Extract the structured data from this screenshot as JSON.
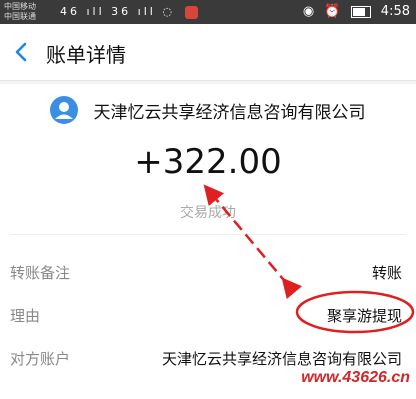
{
  "status_bar": {
    "carrier_1": "中国移动",
    "carrier_2": "中国联通",
    "signal_icons": "46 ıll 36 ıll",
    "time": "4:58",
    "colors": {
      "background": "#3a3a3a",
      "app_badge": "#d8453b"
    }
  },
  "nav": {
    "title": "账单详情",
    "back_icon": "chevron-left-icon",
    "accent": "#1b88e6"
  },
  "transaction": {
    "merchant_name": "天津忆云共享经济信息咨询有限公司",
    "merchant_icon": "user-avatar-icon",
    "amount": "+322.00",
    "status": "交易成功"
  },
  "details": [
    {
      "label": "转账备注",
      "value": "转账"
    },
    {
      "label": "理由",
      "value": "聚享游提现"
    },
    {
      "label": "对方账户",
      "value": "天津忆云共享经济信息咨询有限公司"
    }
  ],
  "annotation": {
    "color": "#e02020",
    "watermark": "www.43626.cn"
  }
}
